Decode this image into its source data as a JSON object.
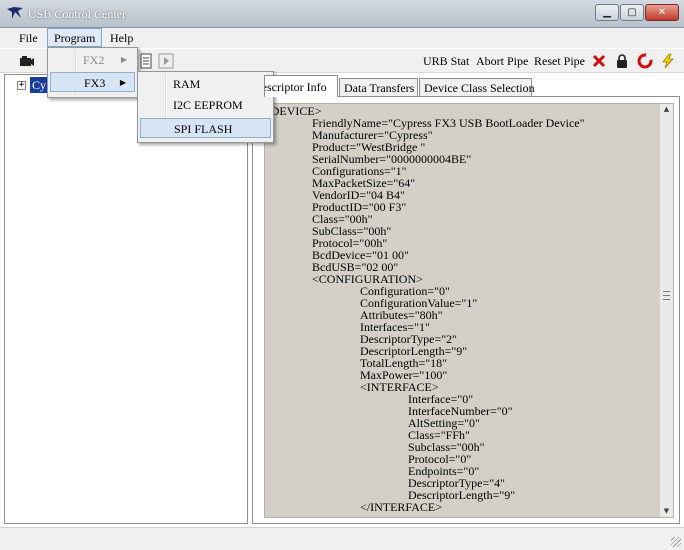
{
  "window": {
    "title": "USB Control Center"
  },
  "menu": {
    "file": "File",
    "program": "Program",
    "help": "Help"
  },
  "program_menu": {
    "fx2": "FX2",
    "fx3": "FX3"
  },
  "fx3_submenu": {
    "ram": "RAM",
    "i2c": "I2C EEPROM",
    "spi": "SPI FLASH"
  },
  "toolbar": {
    "urb_stat": "URB Stat",
    "abort_pipe": "Abort Pipe",
    "reset_pipe": "Reset Pipe"
  },
  "tree": {
    "device": "Cy"
  },
  "tabs": {
    "descriptor_info": "Descriptor Info",
    "data_transfers": "Data Transfers",
    "device_class": "Device Class Selection"
  },
  "descriptor_lines": [
    "<DEVICE>",
    "FriendlyName=\"Cypress FX3 USB BootLoader Device\"",
    "Manufacturer=\"Cypress\"",
    "Product=\"WestBridge \"",
    "SerialNumber=\"0000000004BE\"",
    "Configurations=\"1\"",
    "MaxPacketSize=\"64\"",
    "VendorID=\"04 B4\"",
    "ProductID=\"00 F3\"",
    "Class=\"00h\"",
    "SubClass=\"00h\"",
    "Protocol=\"00h\"",
    "BcdDevice=\"01 00\"",
    "BcdUSB=\"02 00\"",
    "<CONFIGURATION>",
    "Configuration=\"0\"",
    "ConfigurationValue=\"1\"",
    "Attributes=\"80h\"",
    "Interfaces=\"1\"",
    "DescriptorType=\"2\"",
    "DescriptorLength=\"9\"",
    "TotalLength=\"18\"",
    "MaxPower=\"100\"",
    "<INTERFACE>",
    "Interface=\"0\"",
    "InterfaceNumber=\"0\"",
    "AltSetting=\"0\"",
    "Class=\"FFh\"",
    "Subclass=\"00h\"",
    "Protocol=\"0\"",
    "Endpoints=\"0\"",
    "DescriptorType=\"4\"",
    "DescriptorLength=\"9\"",
    "</INTERFACE>"
  ],
  "colors": {
    "selection": "#1a3c9c",
    "text_area_bg": "#d4d0c8",
    "menu_highlight": "#d6e4f3"
  }
}
